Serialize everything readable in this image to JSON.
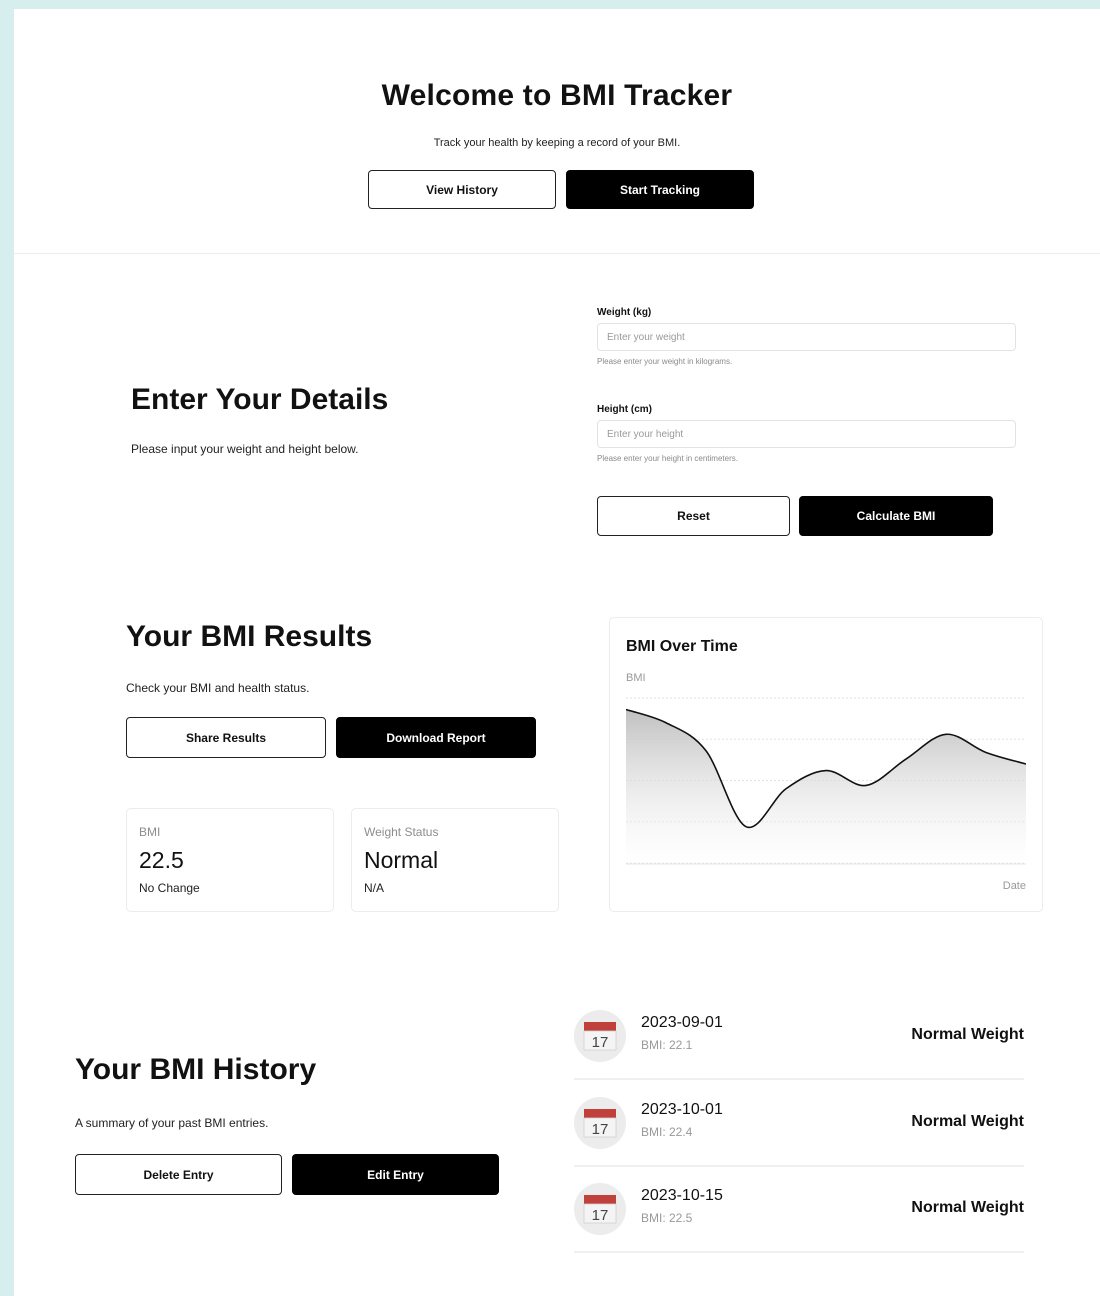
{
  "hero": {
    "title": "Welcome to BMI Tracker",
    "subtitle": "Track your health by keeping a record of your BMI.",
    "view_history": "View History",
    "start_tracking": "Start Tracking"
  },
  "details": {
    "title": "Enter Your Details",
    "description": "Please input your weight and height below.",
    "weight_label": "Weight (kg)",
    "weight_placeholder": "Enter your weight",
    "weight_help": "Please enter your weight in kilograms.",
    "height_label": "Height (cm)",
    "height_placeholder": "Enter your height",
    "height_help": "Please enter your height in centimeters.",
    "reset": "Reset",
    "calculate": "Calculate BMI"
  },
  "results": {
    "title": "Your BMI Results",
    "description": "Check your BMI and health status.",
    "share": "Share Results",
    "download": "Download Report",
    "bmi_card": {
      "label": "BMI",
      "value": "22.5",
      "sub": "No Change"
    },
    "status_card": {
      "label": "Weight Status",
      "value": "Normal",
      "sub": "N/A"
    }
  },
  "chart_data": {
    "type": "area",
    "title": "BMI Over Time",
    "xlabel": "Date",
    "ylabel": "BMI",
    "x": [
      0,
      1,
      2,
      3,
      4,
      5,
      6,
      7,
      8,
      9,
      10
    ],
    "values": [
      0.93,
      0.85,
      0.68,
      0.22,
      0.45,
      0.56,
      0.47,
      0.63,
      0.78,
      0.67,
      0.6
    ],
    "ylim": [
      0,
      1
    ],
    "grid": true,
    "gridlines": 5,
    "fill_color": "#cfcfcf",
    "line_color": "#111111"
  },
  "history": {
    "title": "Your BMI History",
    "description": "A summary of your past BMI entries.",
    "delete": "Delete Entry",
    "edit": "Edit Entry",
    "calendar_day": "17",
    "entries": [
      {
        "date": "2023-09-01",
        "bmi": "BMI: 22.1",
        "status": "Normal Weight"
      },
      {
        "date": "2023-10-01",
        "bmi": "BMI: 22.4",
        "status": "Normal Weight"
      },
      {
        "date": "2023-10-15",
        "bmi": "BMI: 22.5",
        "status": "Normal Weight"
      }
    ]
  },
  "colors": {
    "accent": "#000000",
    "page_border": "#d6eeee",
    "calendar_red": "#c0403c"
  }
}
